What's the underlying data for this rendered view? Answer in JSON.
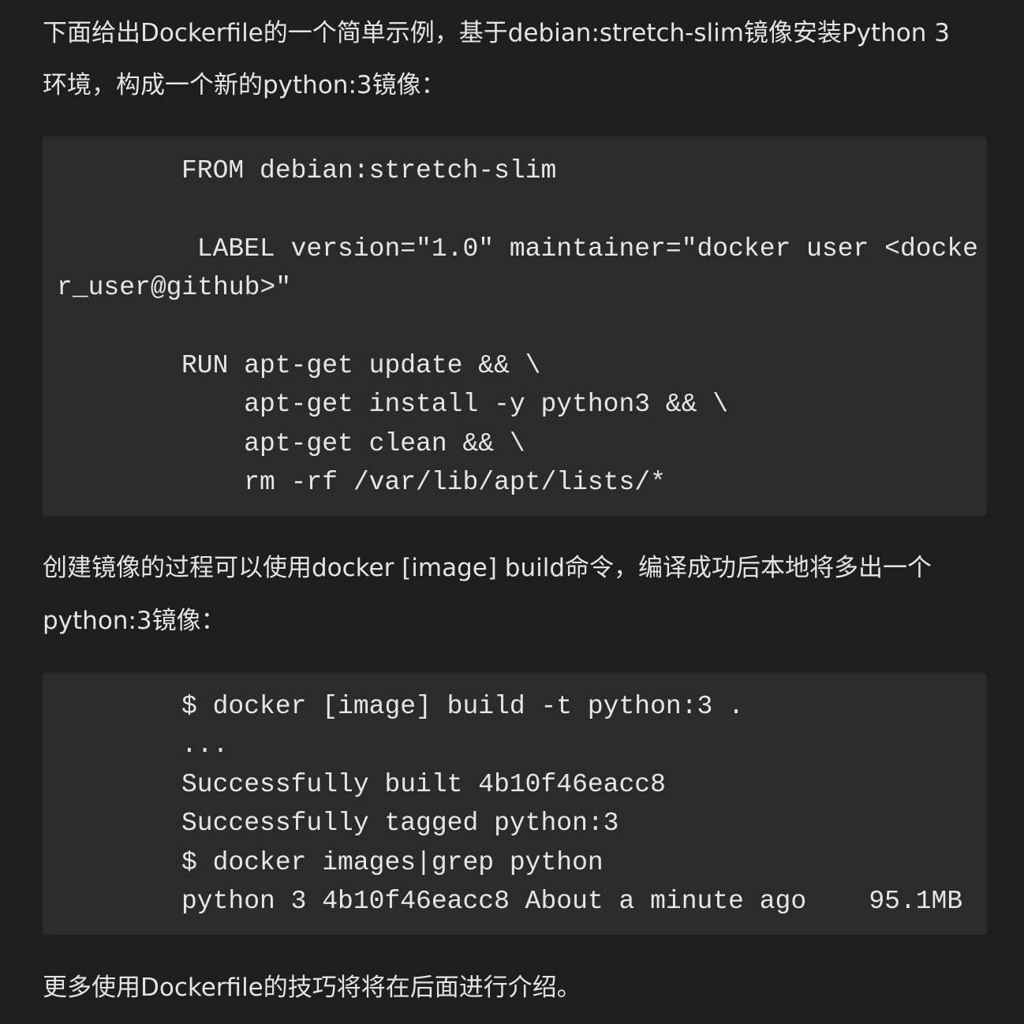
{
  "intro": {
    "line1": "下面给出Dockerfile的一个简单示例，基于debian:stretch-slim镜像安装Python 3",
    "line2": "环境，构成一个新的python:3镜像："
  },
  "dockerfile_code": {
    "lines": [
      "FROM debian:stretch-slim",
      " LABEL version=\"1.0\" maintainer=\"docker user <docke",
      "r_user@github>\"",
      "RUN apt-get update && \\",
      "    apt-get install -y python3 && \\",
      "    apt-get clean && \\",
      "    rm -rf /var/lib/apt/lists/*"
    ]
  },
  "build_text": {
    "line1": "创建镜像的过程可以使用docker [image] build命令，编译成功后本地将多出一个",
    "line2": "python:3镜像："
  },
  "build_code": {
    "lines": [
      "$ docker [image] build -t python:3 .",
      "...",
      "Successfully built 4b10f46eacc8",
      "Successfully tagged python:3",
      "$ docker images|grep python",
      "python 3 4b10f46eacc8 About a minute ago    95.1MB"
    ]
  },
  "outro": {
    "line1": "更多使用Dockerfile的技巧将将在后面进行介绍。"
  }
}
